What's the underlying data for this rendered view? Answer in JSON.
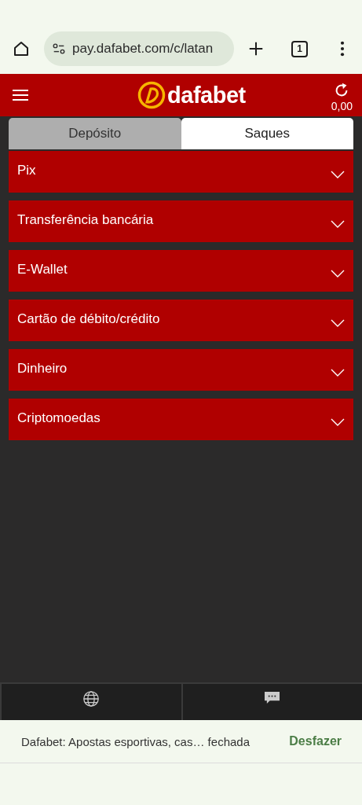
{
  "browser": {
    "url": "pay.dafabet.com/c/latan",
    "tab_count": "1"
  },
  "header": {
    "logo": "dafabet",
    "balance": "0,00"
  },
  "tabs": [
    {
      "label": "Depósito",
      "selected": false
    },
    {
      "label": "Saques",
      "selected": true
    }
  ],
  "methods": [
    {
      "label": "Pix",
      "expanded": false
    },
    {
      "label": "Transferência bancária",
      "expanded": false
    },
    {
      "label": "E-Wallet",
      "expanded": false
    },
    {
      "label": "Cartão de débito/crédito",
      "expanded": false
    },
    {
      "label": "Dinheiro",
      "expanded": false
    },
    {
      "label": "Criptomoedas",
      "expanded": false
    }
  ],
  "snackbar": {
    "message": "Dafabet: Apostas esportivas, cas… fechada",
    "action": "Desfazer"
  }
}
